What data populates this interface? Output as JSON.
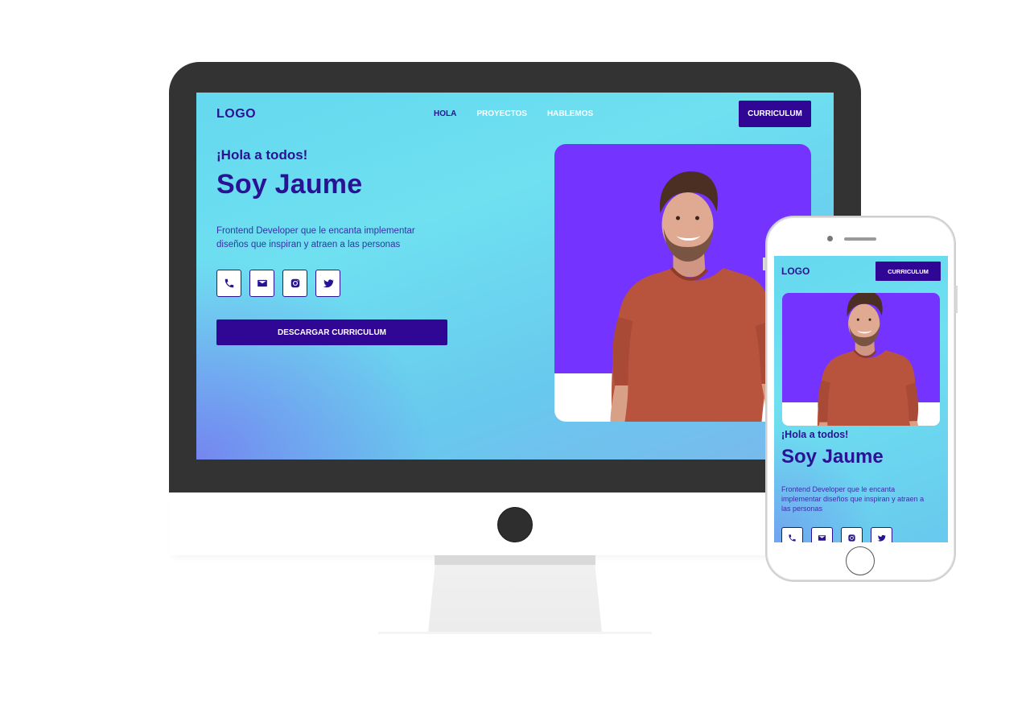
{
  "desktop": {
    "logo": "LOGO",
    "nav": [
      "HOLA",
      "PROYECTOS",
      "HABLEMOS"
    ],
    "cv_button": "CURRICULUM",
    "greeting": "¡Hola a todos!",
    "headline": "Soy Jaume",
    "description": "Frontend Developer que le encanta implementar diseños que inspiran y atraen a las personas",
    "socials": [
      "phone-icon",
      "mail-icon",
      "instagram-icon",
      "twitter-icon"
    ],
    "download_button": "DESCARGAR CURRICULUM"
  },
  "mobile": {
    "logo": "LOGO",
    "cv_button": "CURRICULUM",
    "greeting": "¡Hola a todos!",
    "headline": "Soy Jaume",
    "description": "Frontend Developer que le encanta implementar diseños que inspiran y atraen a las personas",
    "socials": [
      "phone-icon",
      "mail-icon",
      "instagram-icon",
      "twitter-icon"
    ]
  },
  "colors": {
    "brand": "#300794",
    "text": "#2a1294",
    "photo_bg": "#7533ff",
    "bezel": "#333333"
  }
}
